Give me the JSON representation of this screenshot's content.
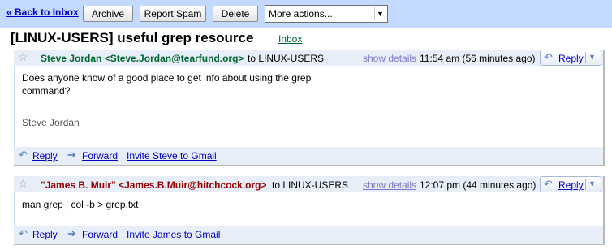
{
  "toolbar": {
    "back": "« Back to Inbox",
    "archive": "Archive",
    "report_spam": "Report Spam",
    "delete": "Delete",
    "more_actions": "More actions..."
  },
  "conversation": {
    "subject": "[LINUX-USERS] useful grep resource",
    "label": "Inbox"
  },
  "messages": [
    {
      "sender": "Steve Jordan <Steve.Jordan@tearfund.org>",
      "sender_color": "#006633",
      "recipient": "to LINUX-USERS",
      "show_details": "show details",
      "time": "11:54 am (56 minutes ago)",
      "reply": "Reply",
      "body_line1": "Does anyone know of a good place to get info about using the grep",
      "body_line2": "command?",
      "signature": "Steve Jordan",
      "footer": {
        "reply": "Reply",
        "forward": "Forward",
        "invite": "Invite Steve to Gmail"
      }
    },
    {
      "sender": "\"James B. Muir\" <James.B.Muir@hitchcock.org>",
      "sender_color": "#990000",
      "recipient": "to LINUX-USERS",
      "show_details": "show details",
      "time": "12:07 pm (44 minutes ago)",
      "reply": "Reply",
      "body_line1": "man grep | col -b > grep.txt",
      "footer": {
        "reply": "Reply",
        "forward": "Forward",
        "invite": "Invite James to Gmail"
      }
    }
  ],
  "icons": {
    "star": "star-icon",
    "reply": "reply-arrow-icon",
    "forward": "forward-arrow-icon",
    "dropdown": "dropdown-arrow-icon"
  }
}
